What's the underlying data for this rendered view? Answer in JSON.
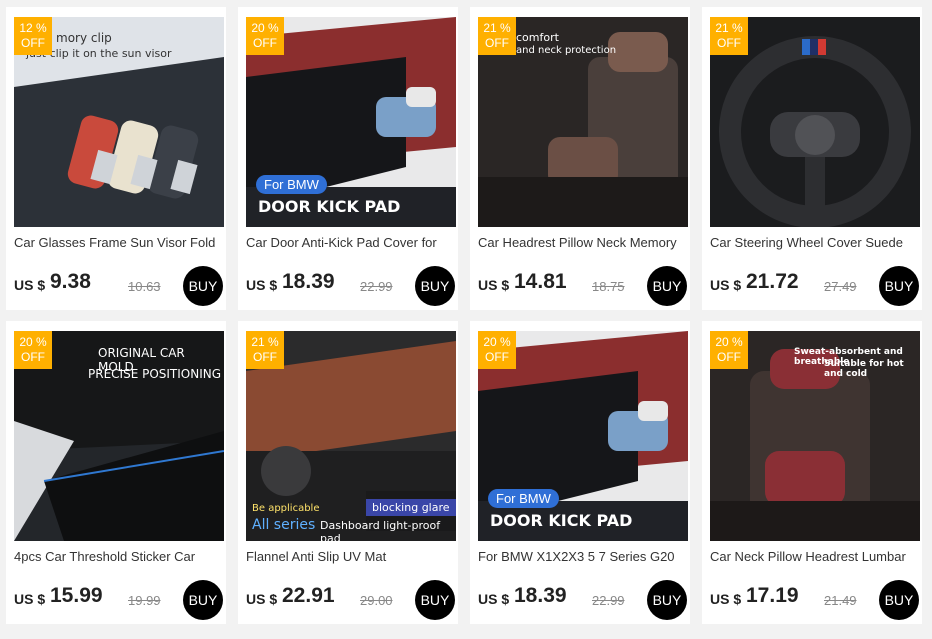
{
  "products": [
    {
      "discount_value": "12 %",
      "discount_label": "OFF",
      "image_text": [
        "mory clip",
        "just clip it on the sun visor"
      ],
      "title": "Car Glasses Frame Sun Visor Fold",
      "currency": "US $",
      "price": "9.38",
      "old_price": "10.63",
      "buy_label": "BUY"
    },
    {
      "discount_value": "20 %",
      "discount_label": "OFF",
      "image_text": [
        "For BMW",
        "DOOR KICK PAD"
      ],
      "title": "Car Door Anti-Kick Pad Cover for",
      "currency": "US $",
      "price": "18.39",
      "old_price": "22.99",
      "buy_label": "BUY"
    },
    {
      "discount_value": "21 %",
      "discount_label": "OFF",
      "image_text": [
        "comfort",
        "and neck protection"
      ],
      "title": "Car Headrest Pillow Neck Memory",
      "currency": "US $",
      "price": "14.81",
      "old_price": "18.75",
      "buy_label": "BUY"
    },
    {
      "discount_value": "21 %",
      "discount_label": "OFF",
      "image_text": [],
      "title": "Car Steering Wheel Cover Suede",
      "currency": "US $",
      "price": "21.72",
      "old_price": "27.49",
      "buy_label": "BUY"
    },
    {
      "discount_value": "20 %",
      "discount_label": "OFF",
      "image_text": [
        "ORIGINAL CAR MOLD",
        "PRECISE POSITIONING"
      ],
      "title": "4pcs Car Threshold Sticker Car",
      "currency": "US $",
      "price": "15.99",
      "old_price": "19.99",
      "buy_label": "BUY"
    },
    {
      "discount_value": "21 %",
      "discount_label": "OFF",
      "image_text": [
        "Be applicable",
        "All series",
        "blocking glare",
        "Dashboard light-proof pad"
      ],
      "title": "Flannel Anti Slip UV Mat",
      "currency": "US $",
      "price": "22.91",
      "old_price": "29.00",
      "buy_label": "BUY"
    },
    {
      "discount_value": "20 %",
      "discount_label": "OFF",
      "image_text": [
        "For BMW",
        "DOOR KICK PAD"
      ],
      "title": "For BMW X1X2X3 5 7 Series G20",
      "currency": "US $",
      "price": "18.39",
      "old_price": "22.99",
      "buy_label": "BUY"
    },
    {
      "discount_value": "20 %",
      "discount_label": "OFF",
      "image_text": [
        "Sweat-absorbent and breathable",
        "Suitable for hot and cold"
      ],
      "title": "Car Neck Pillow Headrest Lumbar",
      "currency": "US $",
      "price": "17.19",
      "old_price": "21.49",
      "buy_label": "BUY"
    }
  ]
}
